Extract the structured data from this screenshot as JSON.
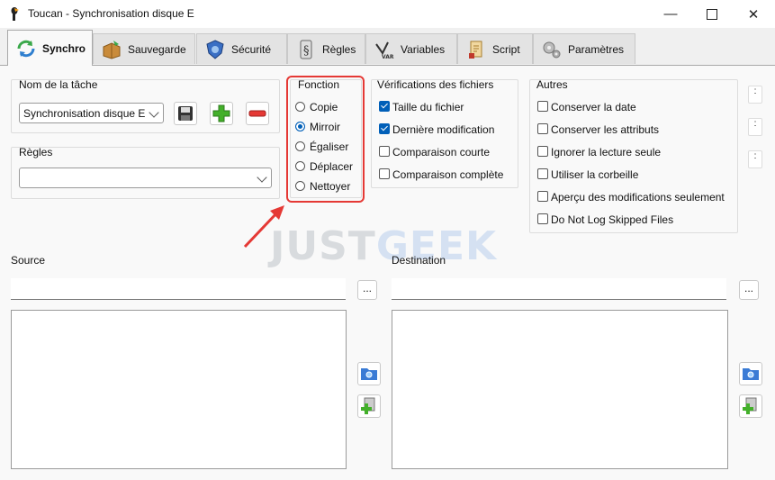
{
  "window": {
    "title": "Toucan - Synchronisation disque E",
    "controls": [
      "minimize",
      "maximize",
      "close"
    ]
  },
  "tabs": [
    {
      "label": "Synchro",
      "icon": "sync-icon",
      "active": true
    },
    {
      "label": "Sauvegarde",
      "icon": "box-icon",
      "active": false
    },
    {
      "label": "Sécurité",
      "icon": "shield-icon",
      "active": false
    },
    {
      "label": "Règles",
      "icon": "rules-icon",
      "active": false
    },
    {
      "label": "Variables",
      "icon": "var-icon",
      "active": false
    },
    {
      "label": "Script",
      "icon": "script-icon",
      "active": false
    },
    {
      "label": "Paramètres",
      "icon": "settings-gears-icon",
      "active": false
    }
  ],
  "task": {
    "label": "Nom de la tâche",
    "value": "Synchronisation disque E"
  },
  "rules": {
    "label": "Règles",
    "value": ""
  },
  "fonction": {
    "label": "Fonction",
    "options": [
      "Copie",
      "Mirroir",
      "Égaliser",
      "Déplacer",
      "Nettoyer"
    ],
    "selected": "Mirroir"
  },
  "verifications": {
    "label": "Vérifications des fichiers",
    "items": [
      {
        "label": "Taille du fichier",
        "checked": true
      },
      {
        "label": "Dernière modification",
        "checked": true
      },
      {
        "label": "Comparaison courte",
        "checked": false
      },
      {
        "label": "Comparaison complète",
        "checked": false
      }
    ]
  },
  "autres": {
    "label": "Autres",
    "items": [
      {
        "label": "Conserver la date",
        "checked": false
      },
      {
        "label": "Conserver les attributs",
        "checked": false
      },
      {
        "label": "Ignorer la lecture seule",
        "checked": false
      },
      {
        "label": "Utiliser la corbeille",
        "checked": false
      },
      {
        "label": "Aperçu des modifications seulement",
        "checked": false
      },
      {
        "label": "Do Not Log Skipped Files",
        "checked": false
      }
    ]
  },
  "source": {
    "label": "Source",
    "value": "",
    "browse": "..."
  },
  "destination": {
    "label": "Destination",
    "value": "",
    "browse": "..."
  },
  "watermark": {
    "text1": "JUST",
    "text2": "GEEK"
  },
  "colors": {
    "accent": "#005fb8",
    "highlight": "#e53935",
    "watermark_dark": "#4a5a6a",
    "watermark_blue": "#3a7bd5"
  }
}
